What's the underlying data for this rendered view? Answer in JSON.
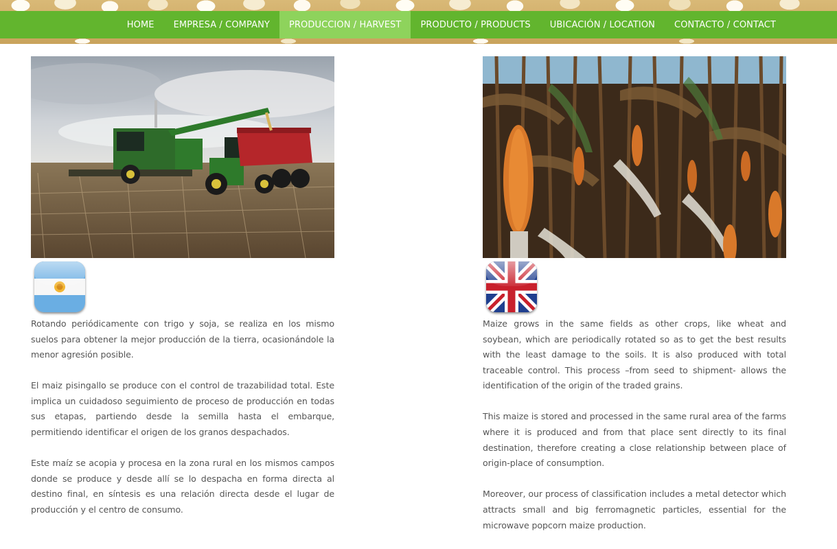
{
  "nav": {
    "items": [
      {
        "label": "HOME"
      },
      {
        "label": "EMPRESA / COMPANY"
      },
      {
        "label": "PRODUCCION / HARVEST",
        "active": true
      },
      {
        "label": "PRODUCTO / PRODUCTS"
      },
      {
        "label": "UBICACIÓN / LOCATION"
      },
      {
        "label": "CONTACTO / CONTACT"
      }
    ]
  },
  "colors": {
    "nav_bg": "#62b52e",
    "nav_active_bg": "#8ed35c",
    "body_text": "#555555"
  },
  "left": {
    "photo": "combine-harvester-unloading-into-grain-cart-photo",
    "flag_icon": "argentina-flag-icon",
    "paragraphs": [
      "Rotando periódicamente con trigo y soja, se realiza en los mismo suelos para obtener la mejor producción de la tierra, ocasionándole la menor agresión posible.",
      "El maiz pisingallo se produce con el control de trazabilidad total. Este implica un cuidadoso seguimiento de proceso de producción  en todas sus etapas, partiendo desde la semilla hasta el embarque, permitiendo identificar el origen de los granos despachados.",
      "Este maíz se acopia y procesa en la zona rural en los mismos campos donde se produce y desde allí se lo despacha en forma directa al destino final, en síntesis es una relación directa desde el lugar de producción y el centro de consumo."
    ]
  },
  "right": {
    "photo": "popcorn-maize-field-photo",
    "flag_icon": "united-kingdom-flag-icon",
    "paragraphs": [
      "Maize grows in the same fields as other crops, like wheat and soybean, which are periodically rotated so as to get the best results with the least damage to the soils. It is also produced with total traceable control. This process –from seed to shipment- allows the identification of the origin of the traded grains.",
      "This maize is stored and processed in the same rural area of the farms where it is produced and from that place sent directly to its final destination, therefore creating a close relationship between place of origin-place of consumption.",
      "Moreover, our process of classification includes a metal detector which attracts small and big ferromagnetic particles, essential for the microwave popcorn maize production."
    ]
  }
}
